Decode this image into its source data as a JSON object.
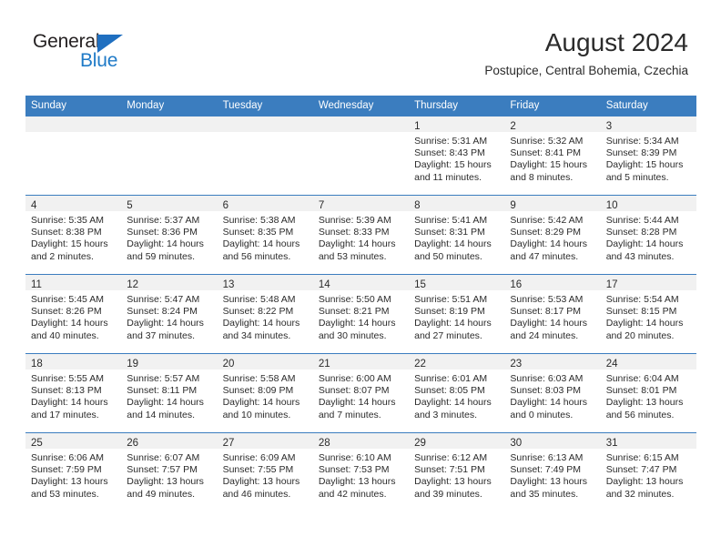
{
  "brand": {
    "name_part1": "General",
    "name_part2": "Blue",
    "triangle_color": "#1f6fc0",
    "blue_color": "#1f7ac7"
  },
  "header": {
    "title": "August 2024",
    "subtitle": "Postupice, Central Bohemia, Czechia"
  },
  "theme": {
    "header_bg": "#3b7dbf",
    "daynum_band_bg": "#f1f1f1",
    "row_divider": "#3b7dbf",
    "text": "#2b2b2b"
  },
  "weekday_headers": [
    "Sunday",
    "Monday",
    "Tuesday",
    "Wednesday",
    "Thursday",
    "Friday",
    "Saturday"
  ],
  "weeks": [
    [
      {
        "day": "",
        "empty": true,
        "sunrise": "",
        "sunset": "",
        "daylight_line1": "",
        "daylight_line2": ""
      },
      {
        "day": "",
        "empty": true,
        "sunrise": "",
        "sunset": "",
        "daylight_line1": "",
        "daylight_line2": ""
      },
      {
        "day": "",
        "empty": true,
        "sunrise": "",
        "sunset": "",
        "daylight_line1": "",
        "daylight_line2": ""
      },
      {
        "day": "",
        "empty": true,
        "sunrise": "",
        "sunset": "",
        "daylight_line1": "",
        "daylight_line2": ""
      },
      {
        "day": "1",
        "sunrise": "Sunrise: 5:31 AM",
        "sunset": "Sunset: 8:43 PM",
        "daylight_line1": "Daylight: 15 hours",
        "daylight_line2": "and 11 minutes."
      },
      {
        "day": "2",
        "sunrise": "Sunrise: 5:32 AM",
        "sunset": "Sunset: 8:41 PM",
        "daylight_line1": "Daylight: 15 hours",
        "daylight_line2": "and 8 minutes."
      },
      {
        "day": "3",
        "sunrise": "Sunrise: 5:34 AM",
        "sunset": "Sunset: 8:39 PM",
        "daylight_line1": "Daylight: 15 hours",
        "daylight_line2": "and 5 minutes."
      }
    ],
    [
      {
        "day": "4",
        "sunrise": "Sunrise: 5:35 AM",
        "sunset": "Sunset: 8:38 PM",
        "daylight_line1": "Daylight: 15 hours",
        "daylight_line2": "and 2 minutes."
      },
      {
        "day": "5",
        "sunrise": "Sunrise: 5:37 AM",
        "sunset": "Sunset: 8:36 PM",
        "daylight_line1": "Daylight: 14 hours",
        "daylight_line2": "and 59 minutes."
      },
      {
        "day": "6",
        "sunrise": "Sunrise: 5:38 AM",
        "sunset": "Sunset: 8:35 PM",
        "daylight_line1": "Daylight: 14 hours",
        "daylight_line2": "and 56 minutes."
      },
      {
        "day": "7",
        "sunrise": "Sunrise: 5:39 AM",
        "sunset": "Sunset: 8:33 PM",
        "daylight_line1": "Daylight: 14 hours",
        "daylight_line2": "and 53 minutes."
      },
      {
        "day": "8",
        "sunrise": "Sunrise: 5:41 AM",
        "sunset": "Sunset: 8:31 PM",
        "daylight_line1": "Daylight: 14 hours",
        "daylight_line2": "and 50 minutes."
      },
      {
        "day": "9",
        "sunrise": "Sunrise: 5:42 AM",
        "sunset": "Sunset: 8:29 PM",
        "daylight_line1": "Daylight: 14 hours",
        "daylight_line2": "and 47 minutes."
      },
      {
        "day": "10",
        "sunrise": "Sunrise: 5:44 AM",
        "sunset": "Sunset: 8:28 PM",
        "daylight_line1": "Daylight: 14 hours",
        "daylight_line2": "and 43 minutes."
      }
    ],
    [
      {
        "day": "11",
        "sunrise": "Sunrise: 5:45 AM",
        "sunset": "Sunset: 8:26 PM",
        "daylight_line1": "Daylight: 14 hours",
        "daylight_line2": "and 40 minutes."
      },
      {
        "day": "12",
        "sunrise": "Sunrise: 5:47 AM",
        "sunset": "Sunset: 8:24 PM",
        "daylight_line1": "Daylight: 14 hours",
        "daylight_line2": "and 37 minutes."
      },
      {
        "day": "13",
        "sunrise": "Sunrise: 5:48 AM",
        "sunset": "Sunset: 8:22 PM",
        "daylight_line1": "Daylight: 14 hours",
        "daylight_line2": "and 34 minutes."
      },
      {
        "day": "14",
        "sunrise": "Sunrise: 5:50 AM",
        "sunset": "Sunset: 8:21 PM",
        "daylight_line1": "Daylight: 14 hours",
        "daylight_line2": "and 30 minutes."
      },
      {
        "day": "15",
        "sunrise": "Sunrise: 5:51 AM",
        "sunset": "Sunset: 8:19 PM",
        "daylight_line1": "Daylight: 14 hours",
        "daylight_line2": "and 27 minutes."
      },
      {
        "day": "16",
        "sunrise": "Sunrise: 5:53 AM",
        "sunset": "Sunset: 8:17 PM",
        "daylight_line1": "Daylight: 14 hours",
        "daylight_line2": "and 24 minutes."
      },
      {
        "day": "17",
        "sunrise": "Sunrise: 5:54 AM",
        "sunset": "Sunset: 8:15 PM",
        "daylight_line1": "Daylight: 14 hours",
        "daylight_line2": "and 20 minutes."
      }
    ],
    [
      {
        "day": "18",
        "sunrise": "Sunrise: 5:55 AM",
        "sunset": "Sunset: 8:13 PM",
        "daylight_line1": "Daylight: 14 hours",
        "daylight_line2": "and 17 minutes."
      },
      {
        "day": "19",
        "sunrise": "Sunrise: 5:57 AM",
        "sunset": "Sunset: 8:11 PM",
        "daylight_line1": "Daylight: 14 hours",
        "daylight_line2": "and 14 minutes."
      },
      {
        "day": "20",
        "sunrise": "Sunrise: 5:58 AM",
        "sunset": "Sunset: 8:09 PM",
        "daylight_line1": "Daylight: 14 hours",
        "daylight_line2": "and 10 minutes."
      },
      {
        "day": "21",
        "sunrise": "Sunrise: 6:00 AM",
        "sunset": "Sunset: 8:07 PM",
        "daylight_line1": "Daylight: 14 hours",
        "daylight_line2": "and 7 minutes."
      },
      {
        "day": "22",
        "sunrise": "Sunrise: 6:01 AM",
        "sunset": "Sunset: 8:05 PM",
        "daylight_line1": "Daylight: 14 hours",
        "daylight_line2": "and 3 minutes."
      },
      {
        "day": "23",
        "sunrise": "Sunrise: 6:03 AM",
        "sunset": "Sunset: 8:03 PM",
        "daylight_line1": "Daylight: 14 hours",
        "daylight_line2": "and 0 minutes."
      },
      {
        "day": "24",
        "sunrise": "Sunrise: 6:04 AM",
        "sunset": "Sunset: 8:01 PM",
        "daylight_line1": "Daylight: 13 hours",
        "daylight_line2": "and 56 minutes."
      }
    ],
    [
      {
        "day": "25",
        "sunrise": "Sunrise: 6:06 AM",
        "sunset": "Sunset: 7:59 PM",
        "daylight_line1": "Daylight: 13 hours",
        "daylight_line2": "and 53 minutes."
      },
      {
        "day": "26",
        "sunrise": "Sunrise: 6:07 AM",
        "sunset": "Sunset: 7:57 PM",
        "daylight_line1": "Daylight: 13 hours",
        "daylight_line2": "and 49 minutes."
      },
      {
        "day": "27",
        "sunrise": "Sunrise: 6:09 AM",
        "sunset": "Sunset: 7:55 PM",
        "daylight_line1": "Daylight: 13 hours",
        "daylight_line2": "and 46 minutes."
      },
      {
        "day": "28",
        "sunrise": "Sunrise: 6:10 AM",
        "sunset": "Sunset: 7:53 PM",
        "daylight_line1": "Daylight: 13 hours",
        "daylight_line2": "and 42 minutes."
      },
      {
        "day": "29",
        "sunrise": "Sunrise: 6:12 AM",
        "sunset": "Sunset: 7:51 PM",
        "daylight_line1": "Daylight: 13 hours",
        "daylight_line2": "and 39 minutes."
      },
      {
        "day": "30",
        "sunrise": "Sunrise: 6:13 AM",
        "sunset": "Sunset: 7:49 PM",
        "daylight_line1": "Daylight: 13 hours",
        "daylight_line2": "and 35 minutes."
      },
      {
        "day": "31",
        "sunrise": "Sunrise: 6:15 AM",
        "sunset": "Sunset: 7:47 PM",
        "daylight_line1": "Daylight: 13 hours",
        "daylight_line2": "and 32 minutes."
      }
    ]
  ]
}
